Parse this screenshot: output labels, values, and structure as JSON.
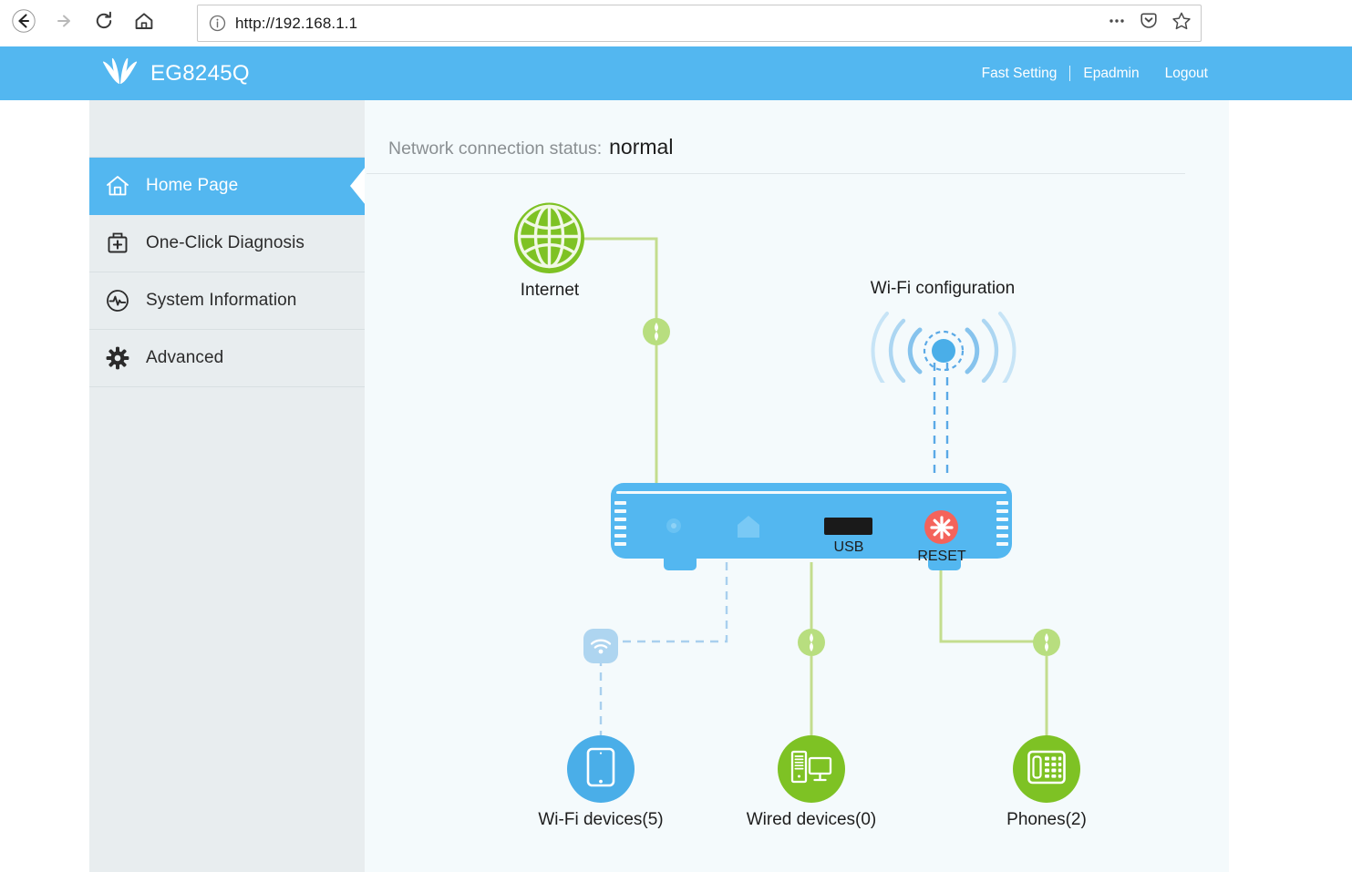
{
  "browser": {
    "url": "http://192.168.1.1",
    "back_icon": "back-arrow-icon",
    "forward_icon": "forward-arrow-icon",
    "reload_icon": "reload-icon",
    "home_icon": "home-icon",
    "info_icon": "page-info-icon",
    "more_icon": "ellipsis-icon",
    "pocket_icon": "pocket-icon",
    "bookmark_icon": "star-icon"
  },
  "header": {
    "brand_name": "EG8245Q",
    "logo_icon": "huawei-logo-icon",
    "nav": [
      {
        "label": "Fast Setting"
      },
      {
        "label": "Epadmin"
      },
      {
        "label": "Logout"
      }
    ]
  },
  "sidebar": {
    "items": [
      {
        "label": "Home Page",
        "icon": "home-icon",
        "active": true
      },
      {
        "label": "One-Click Diagnosis",
        "icon": "medkit-icon",
        "active": false
      },
      {
        "label": "System Information",
        "icon": "pulse-circle-icon",
        "active": false
      },
      {
        "label": "Advanced",
        "icon": "gear-icon",
        "active": false
      }
    ]
  },
  "main": {
    "status_label": "Network connection status:",
    "status_value": "normal",
    "topology": {
      "internet": {
        "label": "Internet",
        "icon": "globe-icon"
      },
      "wifi_config": {
        "label": "Wi-Fi configuration",
        "icon": "wifi-broadcast-icon"
      },
      "router": {
        "usb_label": "USB",
        "reset_label": "RESET",
        "usb_icon": "usb-port-icon",
        "reset_icon": "reset-button-icon",
        "power_icon": "power-indicator-icon",
        "lan_icon": "lan-port-icon"
      },
      "devices": [
        {
          "label": "Wi-Fi devices(5)",
          "icon": "tablet-icon",
          "color": "#4aaee8",
          "count": 5
        },
        {
          "label": "Wired devices(0)",
          "icon": "desktop-pc-icon",
          "color": "#7ec224",
          "count": 0
        },
        {
          "label": "Phones(2)",
          "icon": "desk-phone-icon",
          "color": "#7ec224",
          "count": 2
        }
      ],
      "link_marker_icon": "cable-connector-icon",
      "wifi_node_icon": "wifi-signal-icon"
    }
  },
  "colors": {
    "brand_blue": "#53b7f0",
    "green": "#7ec224",
    "light_green": "#b8de7f",
    "device_blue": "#4aaee8",
    "reset_red": "#f4635b",
    "sidebar_bg": "#e8edef",
    "content_bg": "#f4fafc"
  }
}
